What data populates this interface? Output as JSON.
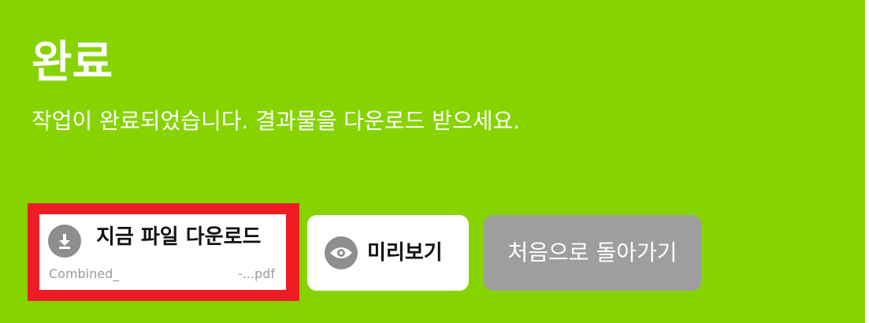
{
  "header": {
    "title": "완료",
    "subtitle": "작업이 완료되었습니다. 결과물을 다운로드 받으세요."
  },
  "download": {
    "label": "지금 파일 다운로드",
    "icon": "download-icon",
    "file_name_start": "Combined_",
    "file_name_end": "-...pdf",
    "highlight_color": "#ee1c25"
  },
  "preview": {
    "label": "미리보기",
    "icon": "eye-icon"
  },
  "back": {
    "label": "처음으로 돌아가기"
  },
  "colors": {
    "background": "#87d300",
    "icon_gray": "#8e8e8e",
    "secondary_button": "#9e9e9e"
  }
}
